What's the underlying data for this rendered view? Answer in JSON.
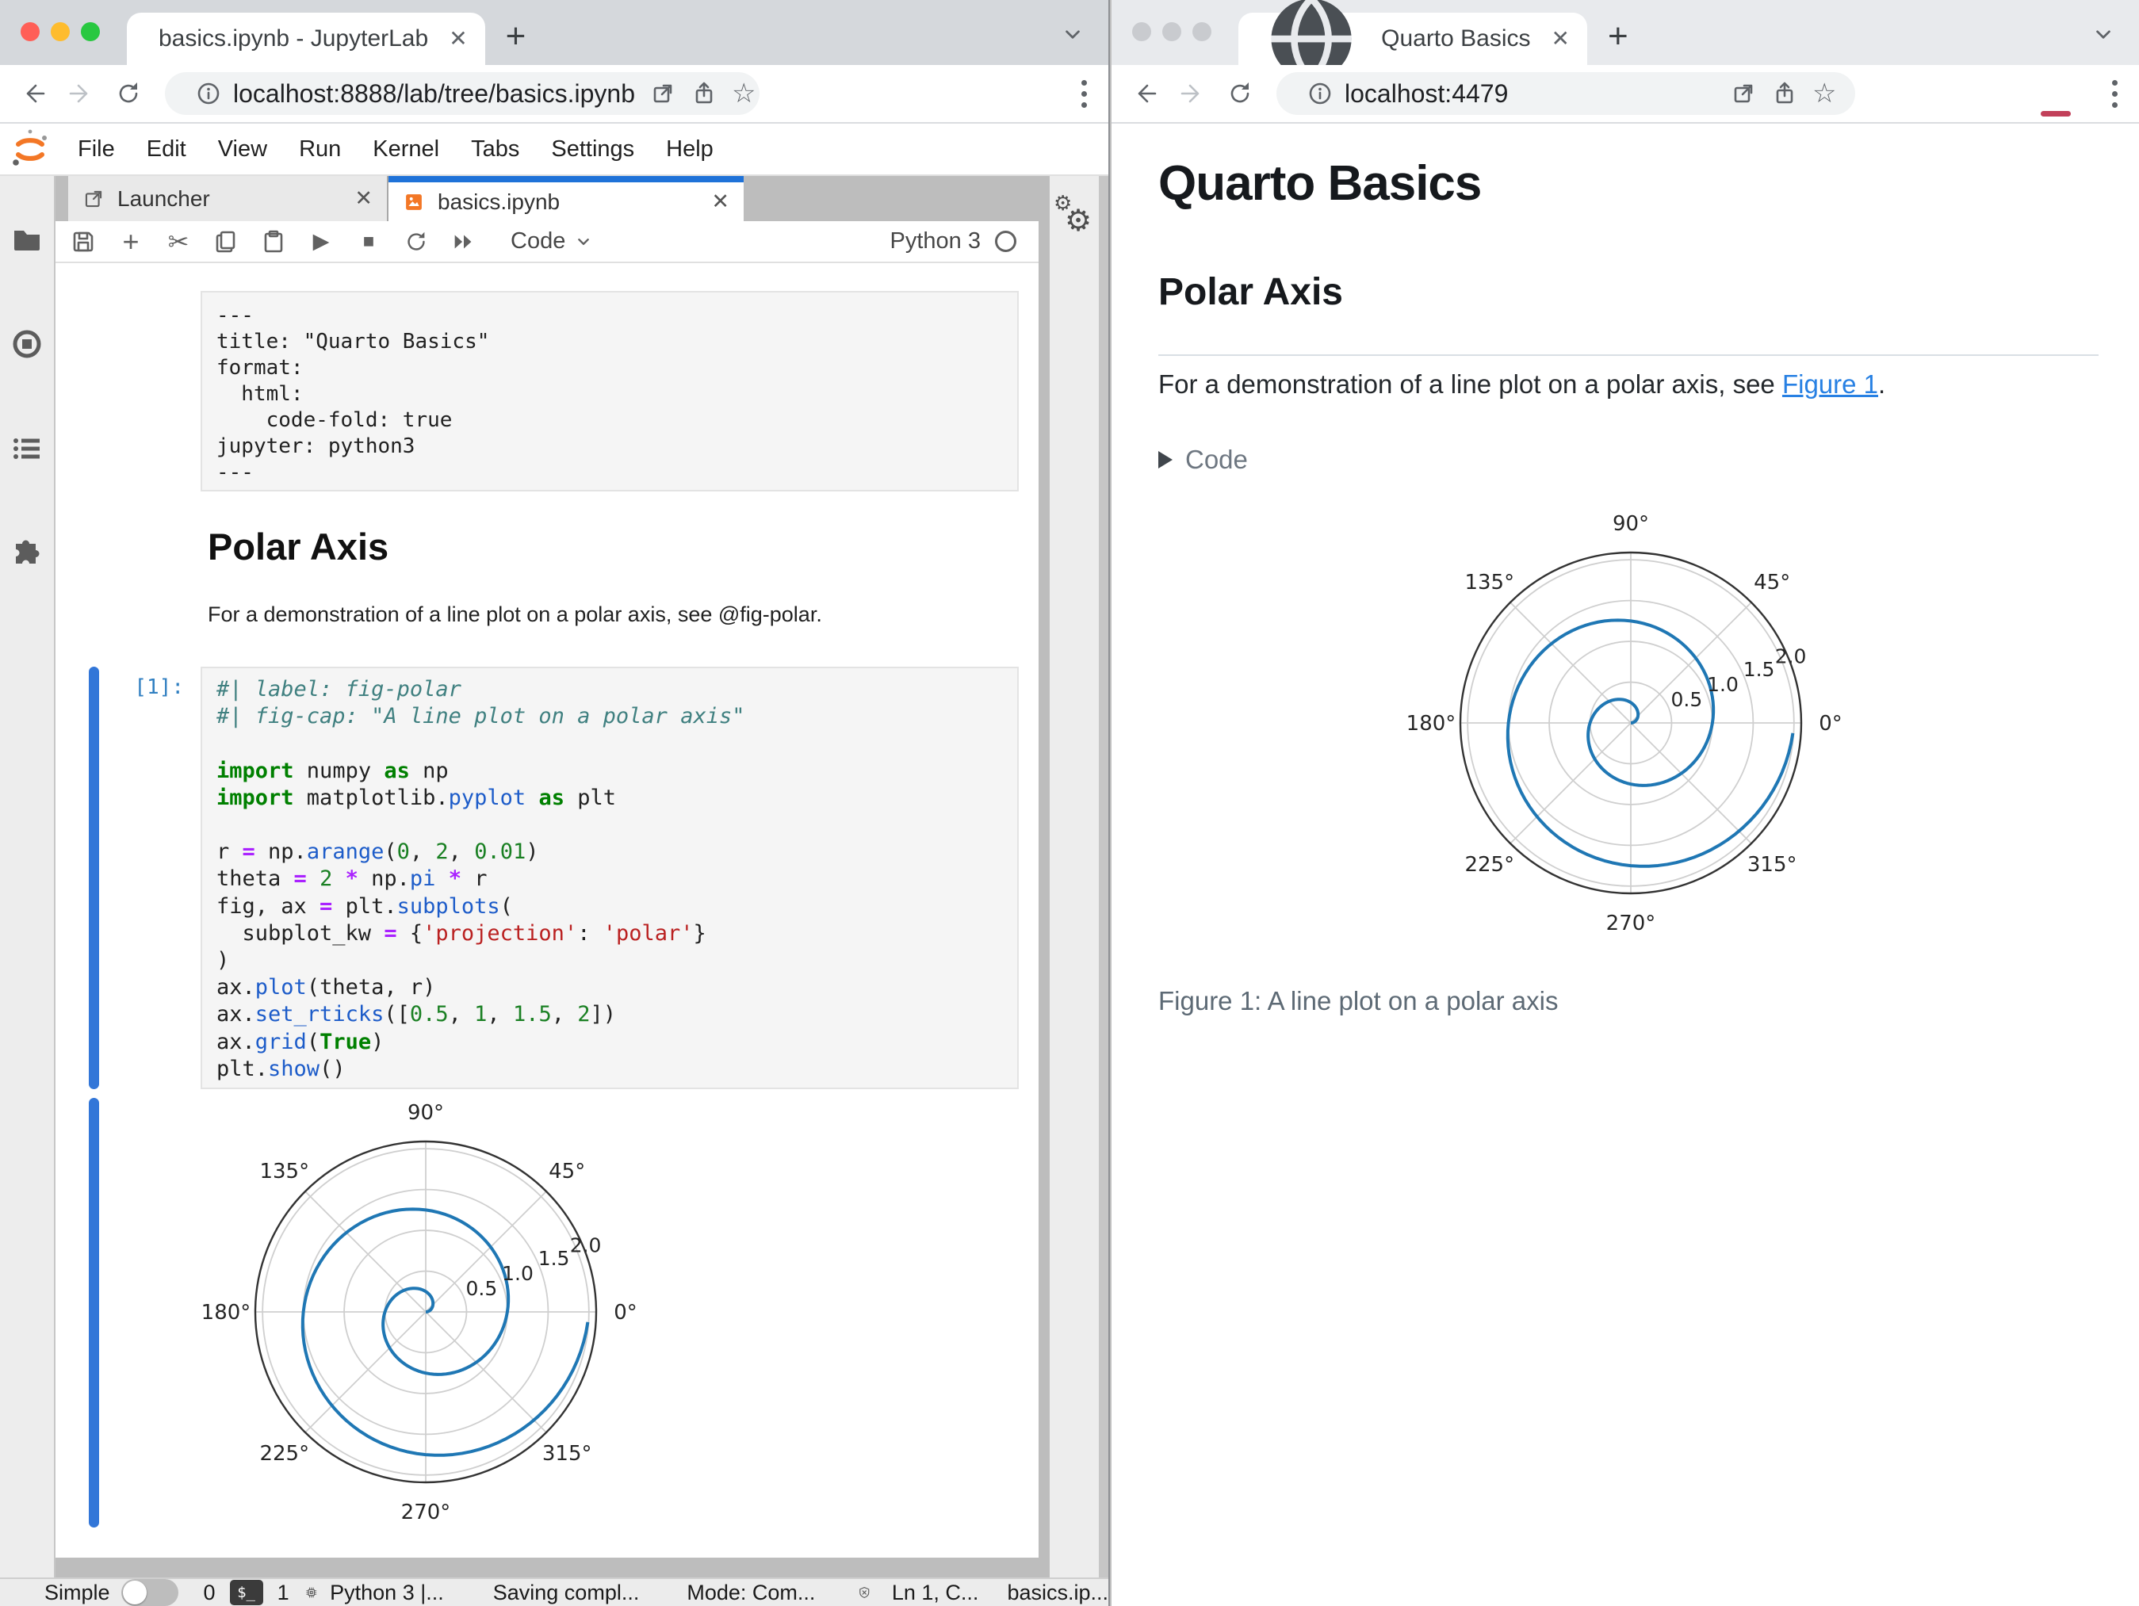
{
  "left_window": {
    "browser": {
      "tab_title": "basics.ipynb - JupyterLab",
      "url": "localhost:8888/lab/tree/basics.ipynb"
    },
    "menu": [
      "File",
      "Edit",
      "View",
      "Run",
      "Kernel",
      "Tabs",
      "Settings",
      "Help"
    ],
    "dock_tabs": {
      "launcher_label": "Launcher",
      "notebook_label": "basics.ipynb"
    },
    "toolbar": {
      "cell_type": "Code",
      "kernel_name": "Python 3"
    },
    "notebook": {
      "raw_lines": [
        "---",
        "title: \"Quarto Basics\"",
        "format:",
        "  html:",
        "    code-fold: true",
        "jupyter: python3",
        "---"
      ],
      "heading": "Polar Axis",
      "paragraph": "For a demonstration of a line plot on a polar axis, see @fig-polar.",
      "prompt": "[1]:",
      "code_lines": [
        [
          [
            "cm",
            "#| label: fig-polar"
          ]
        ],
        [
          [
            "cm",
            "#| fig-cap: \"A line plot on a polar axis\""
          ]
        ],
        [],
        [
          [
            "kw",
            "import"
          ],
          [
            "tx",
            " numpy "
          ],
          [
            "kw",
            "as"
          ],
          [
            "tx",
            " np"
          ]
        ],
        [
          [
            "kw",
            "import"
          ],
          [
            "tx",
            " matplotlib."
          ],
          [
            "fn",
            "pyplot"
          ],
          [
            "tx",
            " "
          ],
          [
            "kw",
            "as"
          ],
          [
            "tx",
            " plt"
          ]
        ],
        [],
        [
          [
            "tx",
            "r "
          ],
          [
            "op",
            "="
          ],
          [
            "tx",
            " np."
          ],
          [
            "fn",
            "arange"
          ],
          [
            "tx",
            "("
          ],
          [
            "nb",
            "0"
          ],
          [
            "tx",
            ", "
          ],
          [
            "nb",
            "2"
          ],
          [
            "tx",
            ", "
          ],
          [
            "nb",
            "0.01"
          ],
          [
            "tx",
            ")"
          ]
        ],
        [
          [
            "tx",
            "theta "
          ],
          [
            "op",
            "="
          ],
          [
            "tx",
            " "
          ],
          [
            "nb",
            "2"
          ],
          [
            "tx",
            " "
          ],
          [
            "op",
            "*"
          ],
          [
            "tx",
            " np."
          ],
          [
            "fn",
            "pi"
          ],
          [
            "tx",
            " "
          ],
          [
            "op",
            "*"
          ],
          [
            "tx",
            " r"
          ]
        ],
        [
          [
            "tx",
            "fig, ax "
          ],
          [
            "op",
            "="
          ],
          [
            "tx",
            " plt."
          ],
          [
            "fn",
            "subplots"
          ],
          [
            "tx",
            "("
          ]
        ],
        [
          [
            "tx",
            "  subplot_kw "
          ],
          [
            "op",
            "="
          ],
          [
            "tx",
            " {"
          ],
          [
            "st",
            "'projection'"
          ],
          [
            "tx",
            ": "
          ],
          [
            "st",
            "'polar'"
          ],
          [
            "tx",
            "}"
          ]
        ],
        [
          [
            "tx",
            ")"
          ]
        ],
        [
          [
            "tx",
            "ax."
          ],
          [
            "fn",
            "plot"
          ],
          [
            "tx",
            "(theta, r)"
          ]
        ],
        [
          [
            "tx",
            "ax."
          ],
          [
            "fn",
            "set_rticks"
          ],
          [
            "tx",
            "(["
          ],
          [
            "nb",
            "0.5"
          ],
          [
            "tx",
            ", "
          ],
          [
            "nb",
            "1"
          ],
          [
            "tx",
            ", "
          ],
          [
            "nb",
            "1.5"
          ],
          [
            "tx",
            ", "
          ],
          [
            "nb",
            "2"
          ],
          [
            "tx",
            "])"
          ]
        ],
        [
          [
            "tx",
            "ax."
          ],
          [
            "fn",
            "grid"
          ],
          [
            "tx",
            "("
          ],
          [
            "kw",
            "True"
          ],
          [
            "tx",
            ")"
          ]
        ],
        [
          [
            "tx",
            "plt."
          ],
          [
            "fn",
            "show"
          ],
          [
            "tx",
            "()"
          ]
        ]
      ]
    },
    "status_bar": {
      "mode_toggle_label": "Simple",
      "terminals_count": "0",
      "kernels_count": "1",
      "kernel_status": "Python 3 |...",
      "saving_status": "Saving compl...",
      "mode_status": "Mode: Com...",
      "cursor_position": "Ln 1, C...",
      "file_name": "basics.ip..."
    }
  },
  "right_window": {
    "browser": {
      "tab_title": "Quarto Basics",
      "url": "localhost:4479"
    },
    "page": {
      "title": "Quarto Basics",
      "section_heading": "Polar Axis",
      "paragraph_prefix": "For a demonstration of a line plot on a polar axis, see ",
      "link_text": "Figure 1",
      "paragraph_suffix": ".",
      "code_toggle_label": "Code",
      "figure_caption": "Figure 1: A line plot on a polar axis"
    }
  },
  "chart_data": {
    "type": "line",
    "projection": "polar",
    "description": "Archimedean spiral: theta = 2*pi*r, r from 0 to 2 step 0.01",
    "series": [
      {
        "name": "ax.plot(theta, r)",
        "r_start": 0,
        "r_end": 1.99,
        "r_step": 0.01
      }
    ],
    "theta_tick_labels": [
      "0°",
      "45°",
      "90°",
      "135°",
      "180°",
      "225°",
      "270°",
      "315°"
    ],
    "theta_tick_angles_deg": [
      0,
      45,
      90,
      135,
      180,
      225,
      270,
      315
    ],
    "r_ticks": [
      0.5,
      1.0,
      1.5,
      2.0
    ],
    "r_tick_labels": [
      "0.5",
      "1.0",
      "1.5",
      "2.0"
    ],
    "r_label_angle_deg": 22.5,
    "r_max": 2.089,
    "grid": true,
    "line_color": "#1f77b4",
    "instances": [
      "jupyterlab-output",
      "quarto-figure-1"
    ]
  }
}
